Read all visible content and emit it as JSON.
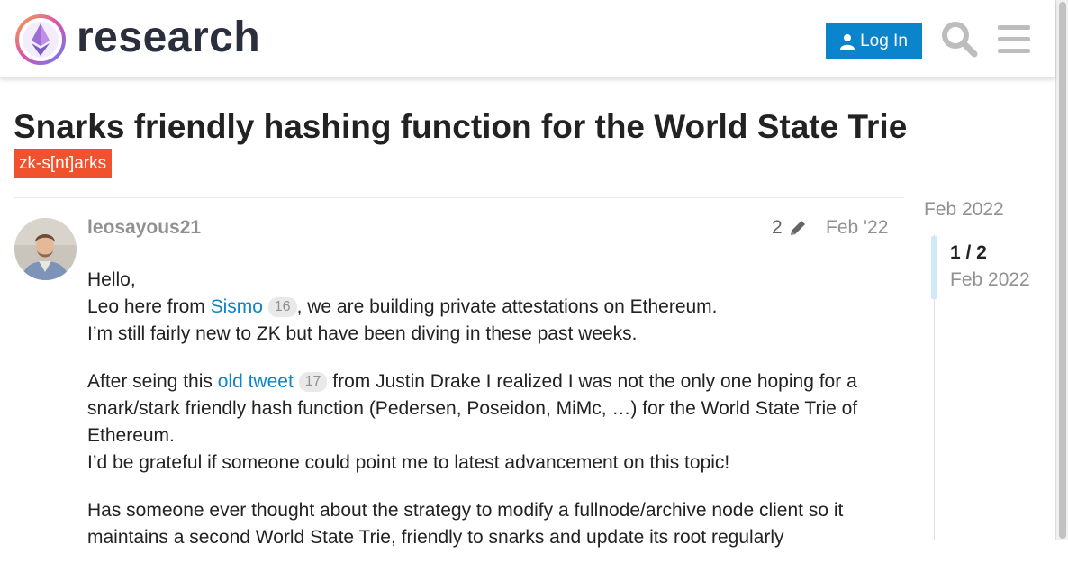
{
  "header": {
    "brand": "research",
    "login_label": "Log In",
    "icons": [
      "logo-icon",
      "user-icon",
      "search-icon",
      "hamburger-menu-icon"
    ]
  },
  "topic": {
    "title": "Snarks friendly hashing function for the World State Trie",
    "tag": "zk-s[nt]arks"
  },
  "post": {
    "username": "leosayous21",
    "edit_count": "2",
    "date": "Feb '22",
    "paragraphs": {
      "p1": {
        "line1": "Hello,",
        "line2_pre": "Leo here from ",
        "link1": "Sismo",
        "link1_clicks": "16",
        "line2_post": ", we are building private attestations on Ethereum.",
        "line3": "I’m still fairly new to ZK but have been diving in these past weeks."
      },
      "p2": {
        "pre": "After seing this ",
        "link": "old tweet",
        "link_clicks": "17",
        "post": " from Justin Drake I realized I was not the only one hoping for a snark/stark friendly hash function (Pedersen, Poseidon, MiMc, …) for the World State Trie of Ethereum.",
        "line2": "I’d be grateful if someone could point me to latest advancement on this topic!"
      },
      "p3": "Has someone ever thought about the strategy to modify a fullnode/archive node client so it maintains a second World State Trie, friendly to snarks and update its root regularly"
    }
  },
  "timeline": {
    "start_date": "Feb 2022",
    "position": "1 / 2",
    "current_date": "Feb 2022"
  },
  "colors": {
    "accent": "#0a84ca",
    "tag": "#f0522d",
    "muted": "#919191"
  }
}
